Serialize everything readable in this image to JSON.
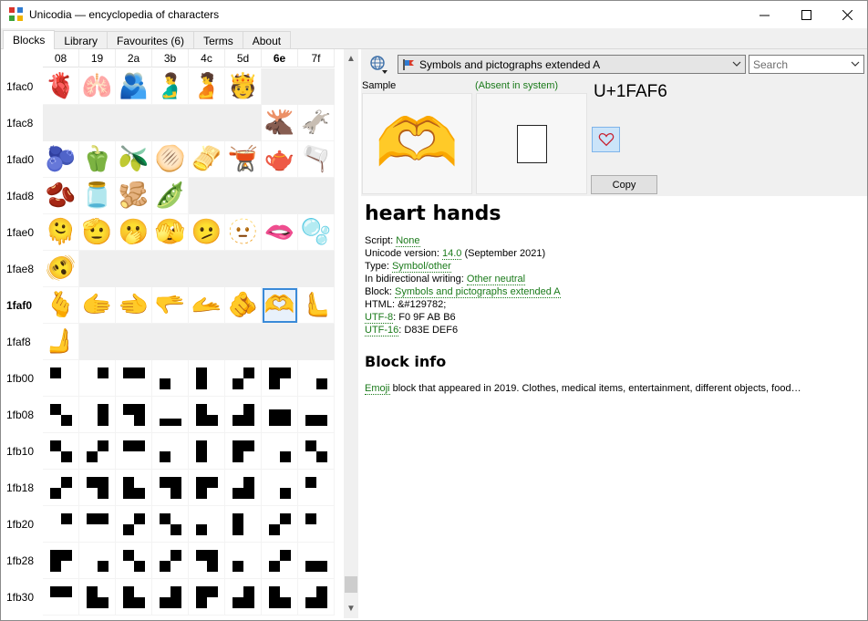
{
  "window": {
    "title": "Unicodia — encyclopedia of characters"
  },
  "tabs": [
    {
      "label": "Blocks",
      "active": true
    },
    {
      "label": "Library",
      "active": false
    },
    {
      "label": "Favourites (6)",
      "active": false
    },
    {
      "label": "Terms",
      "active": false
    },
    {
      "label": "About",
      "active": false
    }
  ],
  "grid": {
    "columns": [
      "08",
      "19",
      "2a",
      "3b",
      "4c",
      "5d",
      "6e",
      "7f"
    ],
    "rows": [
      {
        "label": "1fac0",
        "cells": [
          "🫀",
          "🫁",
          "🫂",
          "🫃",
          "🫄",
          "🫅",
          "",
          ""
        ]
      },
      {
        "label": "1fac8",
        "cells": [
          "",
          "",
          "",
          "",
          "",
          "",
          "🫎",
          "🫏"
        ]
      },
      {
        "label": "1fad0",
        "cells": [
          "🫐",
          "🫑",
          "🫒",
          "🫓",
          "🫔",
          "🫕",
          "🫖",
          "🫗"
        ]
      },
      {
        "label": "1fad8",
        "cells": [
          "🫘",
          "🫙",
          "🫚",
          "🫛",
          "",
          "",
          "",
          ""
        ]
      },
      {
        "label": "1fae0",
        "cells": [
          "🫠",
          "🫡",
          "🫢",
          "🫣",
          "🫤",
          "🫥",
          "🫦",
          "🫧"
        ]
      },
      {
        "label": "1fae8",
        "cells": [
          "🫨",
          "",
          "",
          "",
          "",
          "",
          "",
          ""
        ]
      },
      {
        "label": "1faf0",
        "cells": [
          "🫰",
          "🫱",
          "🫲",
          "🫳",
          "🫴",
          "🫵",
          "🫶",
          "🫷"
        ]
      },
      {
        "label": "1faf8",
        "cells": [
          "🫸",
          "",
          "",
          "",
          "",
          "",
          "",
          ""
        ]
      },
      {
        "label": "1fb00",
        "cells": [
          "▘",
          "▝",
          "▀",
          "▖",
          "▌",
          "▞",
          "▛",
          "▗"
        ]
      },
      {
        "label": "1fb08",
        "cells": [
          "▚",
          "▐",
          "▜",
          "▂",
          "▙",
          "▟",
          "▆",
          "▄"
        ]
      },
      {
        "label": "1fb10",
        "cells": [
          "▚",
          "▞",
          "▀",
          "▖",
          "▌",
          "▛",
          "▗",
          "▚"
        ]
      },
      {
        "label": "1fb18",
        "cells": [
          "▞",
          "▜",
          "▙",
          "▜",
          "▛",
          "▟",
          "▗",
          "▘"
        ]
      },
      {
        "label": "1fb20",
        "cells": [
          "▝",
          "▀",
          "▞",
          "▚",
          "▖",
          "▌",
          "▞",
          "▘"
        ]
      },
      {
        "label": "1fb28",
        "cells": [
          "▛",
          "▗",
          "▚",
          "▞",
          "▜",
          "▖",
          "▞",
          "▄"
        ]
      },
      {
        "label": "1fb30",
        "cells": [
          "▀",
          "▙",
          "▙",
          "▟",
          "▛",
          "▟",
          "▙",
          "▟"
        ]
      }
    ],
    "bold_column": "6e",
    "bold_row": "1faf0",
    "selected": "U+1FAF6"
  },
  "right": {
    "block_select": "Symbols and pictographs extended A",
    "search_placeholder": "Search",
    "sample_label": "Sample",
    "absent_label": "(Absent in system)",
    "code": "U+1FAF6",
    "glyph": "🫶",
    "copy_label": "Copy",
    "name": "heart hands",
    "props": {
      "script_label": "Script: ",
      "script_value": "None",
      "version_label": "Unicode version: ",
      "version_value": "14.0",
      "version_note": " (September 2021)",
      "type_label": "Type: ",
      "type_value": "Symbol/other",
      "bidi_label": "In bidirectional writing: ",
      "bidi_value": "Other neutral",
      "block_label": "Block: ",
      "block_value": "Symbols and pictographs extended A",
      "html_label": "HTML: ",
      "html_value": "&#129782;",
      "utf8_label": "UTF-8",
      "utf8_value": ": F0 9F AB B6",
      "utf16_label": "UTF-16",
      "utf16_value": ": D83E DEF6"
    },
    "block_info_title": "Block info",
    "block_info_link": "Emoji",
    "block_info_text": " block that appeared in 2019. Clothes, medical items, entertainment, different objects, food…"
  },
  "colors": {
    "link": "#1a7a1a",
    "selected_border": "#3a8ad8",
    "fav_bg": "#cbe4f9"
  }
}
